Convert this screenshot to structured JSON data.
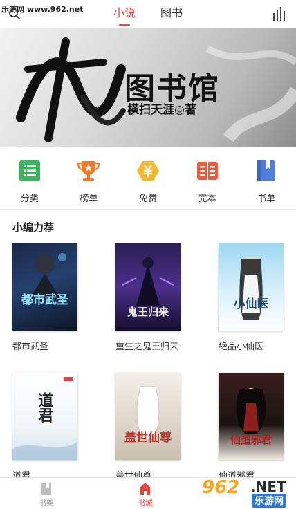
{
  "header": {
    "site_mark": "乐游网 www.962.net",
    "tabs": [
      {
        "label": "小说",
        "active": true
      },
      {
        "label": "图书",
        "active": false
      }
    ],
    "search_icon": "search-icon",
    "rank_icon": "bar-chart-icon"
  },
  "banner": {
    "calligraphy": "天道",
    "title": "图书馆",
    "author": "横扫天涯◎著"
  },
  "categories": [
    {
      "label": "分类",
      "icon": "list-icon",
      "color": "#3bb45e"
    },
    {
      "label": "榜单",
      "icon": "trophy-icon",
      "color": "#f07c2a"
    },
    {
      "label": "免费",
      "icon": "yen-icon",
      "color": "#f5b92d"
    },
    {
      "label": "完本",
      "icon": "book-open-icon",
      "color": "#ef5a3a"
    },
    {
      "label": "书单",
      "icon": "bookmark-icon",
      "color": "#4f7fd9"
    }
  ],
  "section": {
    "title": "小编力荐",
    "books": [
      {
        "name": "都市武圣",
        "cover_text": "都市武圣"
      },
      {
        "name": "重生之鬼王归来",
        "cover_text": "鬼王归来"
      },
      {
        "name": "绝品小仙医",
        "cover_text": "小仙医"
      },
      {
        "name": "道君",
        "cover_text": "道君"
      },
      {
        "name": "盖世仙尊",
        "cover_text": "盖世仙尊"
      },
      {
        "name": "仙道邪君",
        "cover_text": "仙道邪君"
      }
    ]
  },
  "bottom_nav": [
    {
      "label": "书架",
      "icon": "bookshelf-icon",
      "active": false
    },
    {
      "label": "书城",
      "icon": "home-icon",
      "active": true
    }
  ],
  "watermark": {
    "num": "962",
    "dotnet": ".NET",
    "cn": "乐游网"
  },
  "colors": {
    "accent": "#e8453c"
  }
}
